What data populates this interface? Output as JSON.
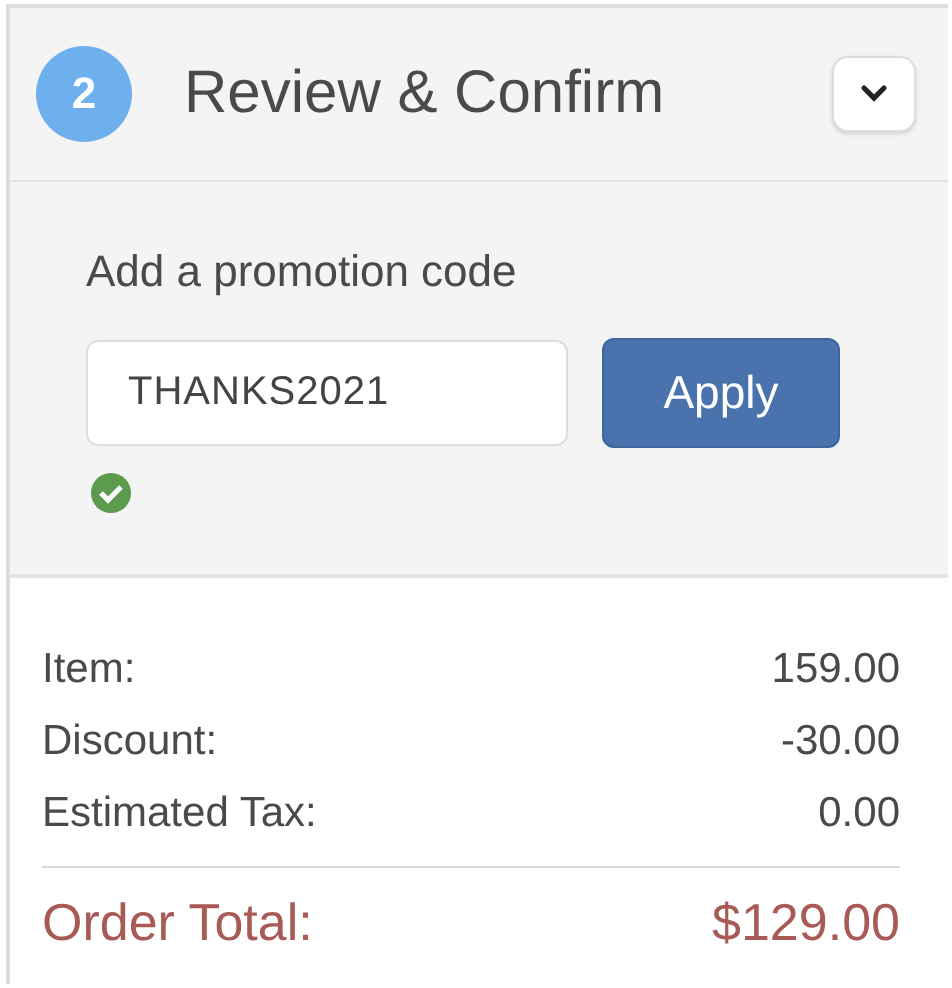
{
  "step": {
    "number": "2",
    "title": "Review & Confirm"
  },
  "promotion": {
    "label": "Add a promotion code",
    "value": "THANKS2021",
    "button": "Apply",
    "applied": true
  },
  "summary": {
    "lines": [
      {
        "label": "Item:",
        "amount": "159.00"
      },
      {
        "label": "Discount:",
        "amount": "-30.00"
      },
      {
        "label": "Estimated Tax:",
        "amount": "0.00"
      }
    ],
    "total": {
      "label": "Order Total:",
      "amount": "$129.00"
    }
  }
}
